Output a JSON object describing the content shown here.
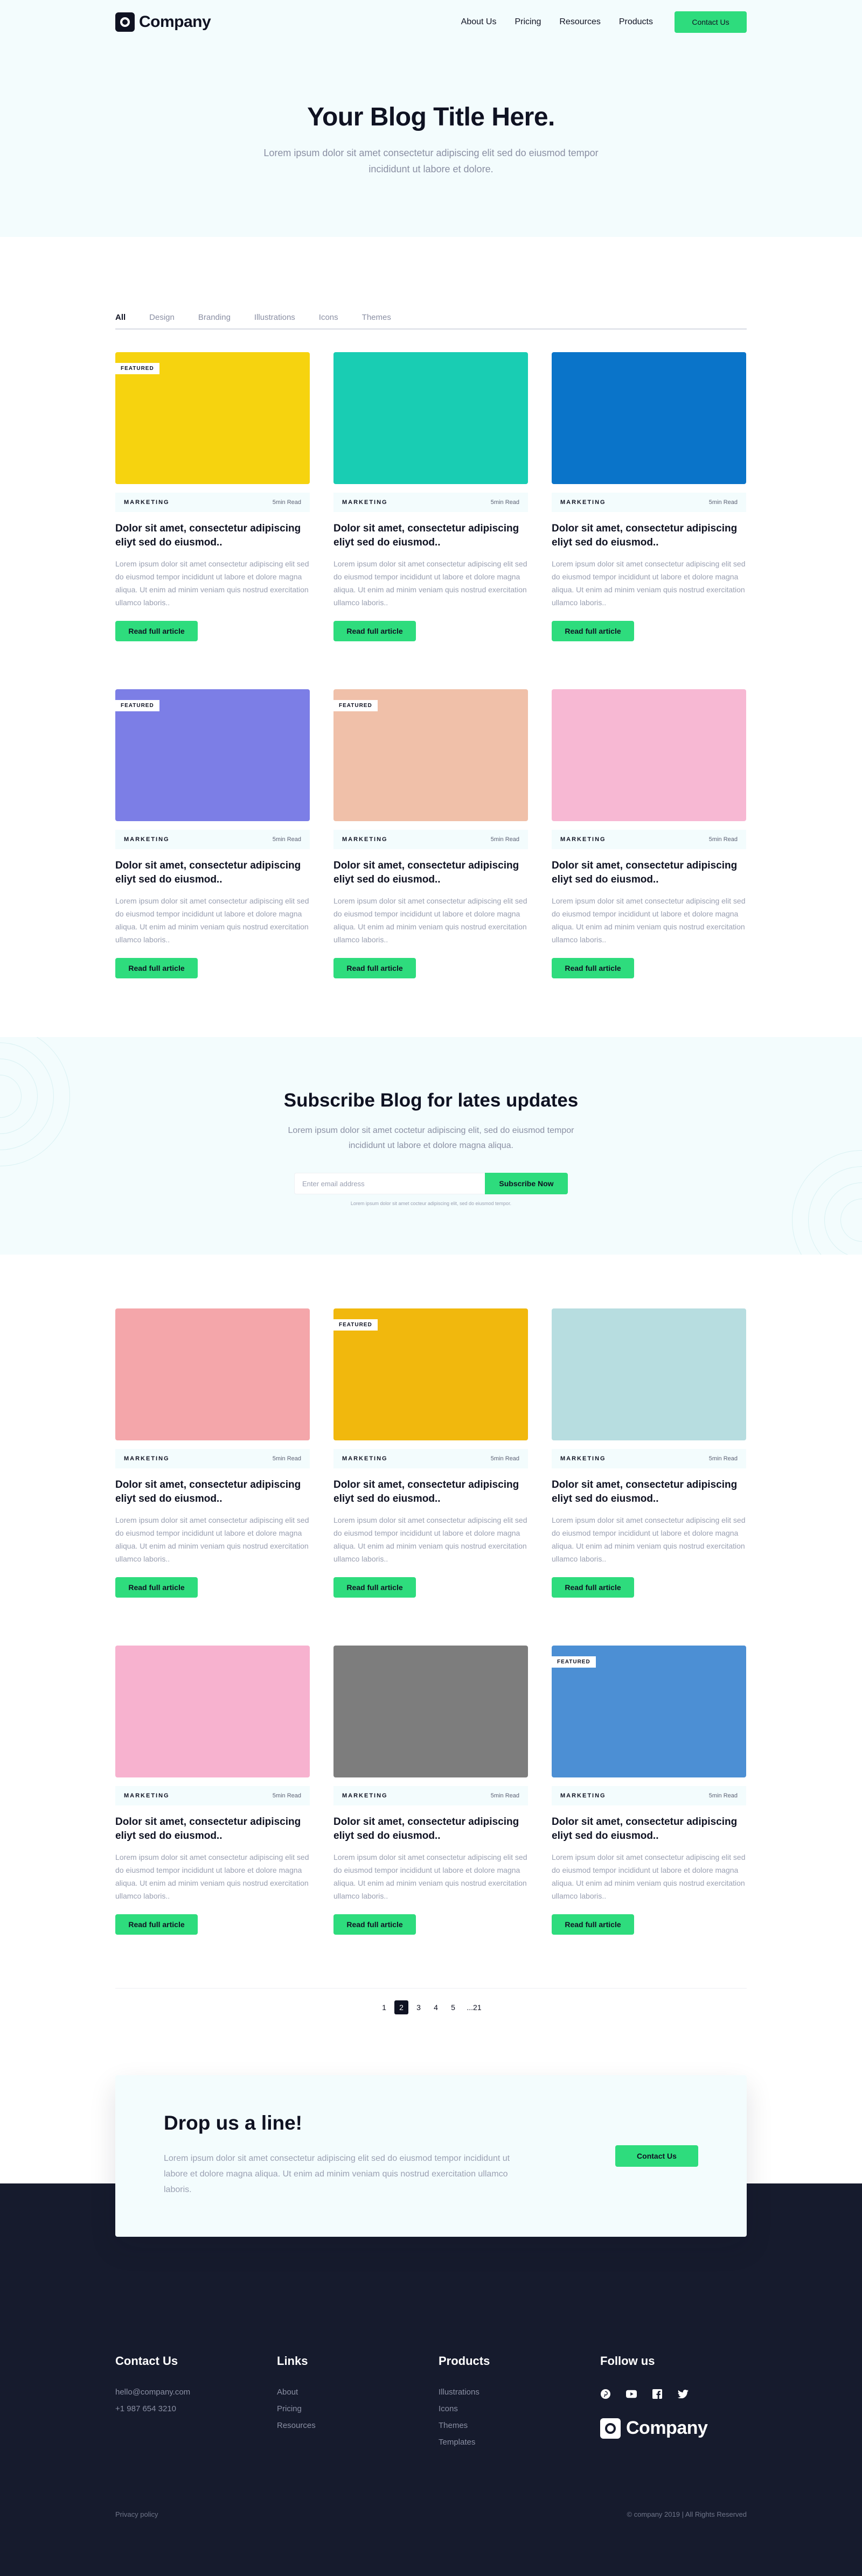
{
  "brand": {
    "name": "Company"
  },
  "nav": {
    "links": [
      "About Us",
      "Pricing",
      "Resources",
      "Products"
    ],
    "cta": "Contact Us"
  },
  "hero": {
    "title": "Your Blog Title Here.",
    "subtitle": "Lorem ipsum dolor sit amet consectetur adipiscing elit sed do eiusmod tempor incididunt ut labore et dolore."
  },
  "tabs": [
    "All",
    "Design",
    "Branding",
    "Illustrations",
    "Icons",
    "Themes"
  ],
  "card_defaults": {
    "category": "MARKETING",
    "read_time": "5min Read",
    "title": "Dolor sit amet, consectetur adipiscing eliyt sed do eiusmod..",
    "excerpt": "Lorem ipsum dolor sit amet consectetur adipiscing elit sed do eiusmod tempor incididunt ut labore et dolore magna aliqua. Ut enim ad minim veniam quis nostrud exercitation ullamco laboris..",
    "button": "Read full article",
    "featured_label": "FEATURED"
  },
  "posts_first": [
    {
      "image": "yellow-flower-basket",
      "bg": "#f6d30f",
      "featured": true
    },
    {
      "image": "teal-wall-flowers",
      "bg": "#19cdb3",
      "featured": false
    },
    {
      "image": "blue-orange-lemon",
      "bg": "#0a74c9",
      "featured": false
    },
    {
      "image": "palm-tree-purple",
      "bg": "#7c7ee6",
      "featured": true
    },
    {
      "image": "peach-branch-blossom",
      "bg": "#f0c0a9",
      "featured": true
    },
    {
      "image": "pink-macarons",
      "bg": "#f7b8d3",
      "featured": false
    }
  ],
  "subscribe": {
    "title": "Subscribe Blog for lates updates",
    "text": "Lorem ipsum dolor sit amet coctetur adipiscing elit, sed do eiusmod tempor incididunt ut labore et dolore magna aliqua.",
    "placeholder": "Enter email address",
    "button": "Subscribe Now",
    "note": "Lorem ipsum dolor sit amet cocteur adipiscing elit, sed do eiusmod tempor."
  },
  "posts_second": [
    {
      "image": "pink-candies",
      "bg": "#f4a6aa",
      "featured": false
    },
    {
      "image": "yellow-pencils",
      "bg": "#f1b80d",
      "featured": true
    },
    {
      "image": "coffee-cup-mint",
      "bg": "#b7dde0",
      "featured": false
    },
    {
      "image": "macaron-stack-pink",
      "bg": "#f7b2cf",
      "featured": false
    },
    {
      "image": "macaron-stack-gray",
      "bg": "#7d7d7d",
      "featured": false
    },
    {
      "image": "blue-clock-tower",
      "bg": "#4c8fd4",
      "featured": true
    }
  ],
  "pagination": {
    "pages": [
      "1",
      "2",
      "3",
      "4",
      "5",
      "...21"
    ],
    "active": "2"
  },
  "contact": {
    "title": "Drop us a line!",
    "text": "Lorem ipsum dolor sit amet consectetur adipiscing elit sed do eiusmod tempor incididunt ut labore et dolore magna aliqua. Ut enim ad minim veniam quis nostrud exercitation ullamco laboris.",
    "button": "Contact Us"
  },
  "footer": {
    "contact": {
      "title": "Contact Us",
      "email": "hello@company.com",
      "phone": "+1 987 654 3210"
    },
    "links": {
      "title": "Links",
      "items": [
        "About",
        "Pricing",
        "Resources"
      ]
    },
    "products": {
      "title": "Products",
      "items": [
        "Illustrations",
        "Icons",
        "Themes",
        "Templates"
      ]
    },
    "follow": {
      "title": "Follow us",
      "icons": [
        "pinterest-icon",
        "youtube-icon",
        "facebook-icon",
        "twitter-icon"
      ]
    },
    "privacy": "Privacy policy",
    "copyright": "© company 2019 | All Rights Reserved"
  },
  "colors": {
    "accent": "#2edc7d",
    "navy": "#161b2d",
    "light_bg": "#f3fcfd"
  }
}
